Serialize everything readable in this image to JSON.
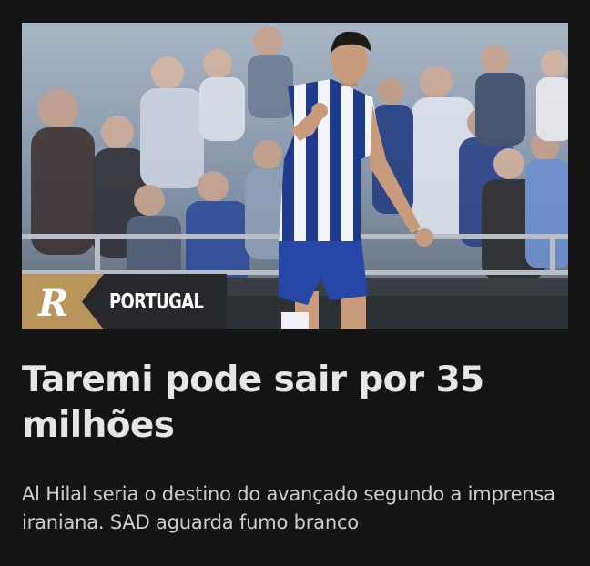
{
  "article": {
    "category": "PORTUGAL",
    "logo_letter": "R",
    "headline": "Taremi pode sair por 35 milhões",
    "summary": "Al Hilal seria o destino do avançado segundo a imprensa iraniana. SAD aguarda fumo branco",
    "image_icon": "player-photo"
  },
  "colors": {
    "background": "#141414",
    "brand_gold": "#b8955a",
    "tag_dark": "#26282b",
    "headline_text": "#e6e6e6",
    "summary_text": "#cfcfcf"
  }
}
